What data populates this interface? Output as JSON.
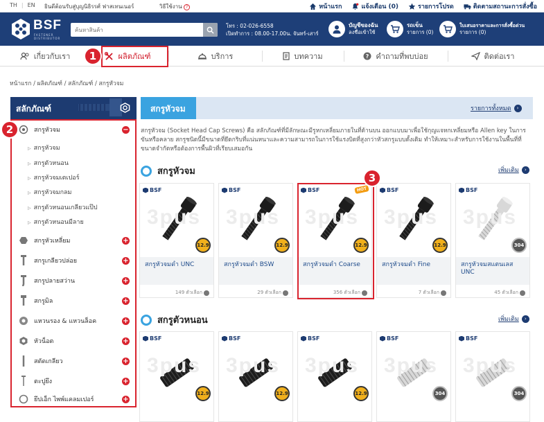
{
  "topbar": {
    "lang_th": "TH",
    "lang_sep": "|",
    "lang_en": "EN",
    "welcome": "ยินดีต้อนรับสู่บุญนิธิรรศ์ ฟาสเทนเนอร์",
    "how": "วิธีใช้งาน",
    "nav": [
      {
        "label": "หน้าแรก",
        "icon": "home-icon"
      },
      {
        "label": "แจ้งเตือน (0)",
        "icon": "bell-icon"
      },
      {
        "label": "รายการโปรด",
        "icon": "star-icon"
      },
      {
        "label": "ติดตามสถานะการสั่งซื้อ",
        "icon": "truck-icon"
      }
    ]
  },
  "header": {
    "brand": "BSF",
    "brand_sub": "FASTENER DISTRIBUTOR",
    "search_placeholder": "ค้นหาสินค้า",
    "phone": "โทร : 02-026-6558",
    "hours": "เปิดทำการ : 08.00-17.00น. จันทร์-เสาร์",
    "account_line1": "บัญชีของฉัน",
    "account_line2": "ลงชื่อเข้าใช้",
    "cart_line1": "รถเข็น",
    "cart_line2": "รายการ (0)",
    "quote_line1": "ใบเสนอราคาและการสั่งซื้อด่วน",
    "quote_line2": "รายการ (0)"
  },
  "catnav": [
    {
      "label": "เกี่ยวกับเรา",
      "icon": "people-icon"
    },
    {
      "label": "ผลิตภัณฑ์",
      "icon": "tools-icon"
    },
    {
      "label": "บริการ",
      "icon": "service-icon"
    },
    {
      "label": "บทความ",
      "icon": "document-icon"
    },
    {
      "label": "คำถามที่พบบ่อย",
      "icon": "help-icon"
    },
    {
      "label": "ติดต่อเรา",
      "icon": "send-icon"
    }
  ],
  "badges": [
    "1",
    "2",
    "3"
  ],
  "breadcrumb": "หน้าแรก / ผลิตภัณฑ์ / สลักภัณฑ์ / สกรูหัวจม",
  "sidebar": {
    "title": "สลักภัณฑ์",
    "categories": [
      {
        "label": "สกรูหัวจม",
        "expanded": true
      },
      {
        "label": "สกรูหัวเหลี่ยม"
      },
      {
        "label": "สกรูเกลียวปล่อย"
      },
      {
        "label": "สกรูปลายสว่าน"
      },
      {
        "label": "สกรูมิล"
      },
      {
        "label": "แหวนรอง & แหวนล็อค"
      },
      {
        "label": "หัวน็อต"
      },
      {
        "label": "สตัดเกลียว"
      },
      {
        "label": "ตะปูยึง"
      },
      {
        "label": "ยึปเอ็ก ไพพ์แคลมเปอร์"
      }
    ],
    "subitems": [
      "สกรูหัวจม",
      "สกรูตัวหนอน",
      "สกรูหัวจมเตเปอร์",
      "สกรูหัวจมกลม",
      "สกรูตัวหนอนเกลียวแป๊ป",
      "สกรูตัวหนอนมีลาย"
    ]
  },
  "banner": {
    "title": "สกรูหัวจม",
    "all_link": "รายการทั้งหมด"
  },
  "description": "สกรูหัวจม (Socket Head Cap Screws) คือ สลักภัณฑ์ที่มีลักษณะมีรูหกเหลี่ยมภายในที่ด้านบน ออกแบบมาเพื่อใช้กุญแจหกเหลี่ยมหรือ Allen key ในการขันหรือคลาย สกรูชนิดนี้มีขนาดที่ยึดกริบที่แน่นหนาและความสามารถในการใช้แรงบิดที่สูงกว่าหัวสกรูแบบดั้งเดิม ทำให้เหมาะสำหรับการใช้งานในพื้นที่ที่ขนาดจำกัดหรือต้องการพื้นผิวที่เรียบเสมอกัน",
  "sections": [
    {
      "title": "สกรูหัวจม",
      "more": "เพิ่มเติม",
      "products": [
        {
          "name": "สกรูหัวจมดำ UNC",
          "count": "149 ตัวเลือก",
          "grade": "12.9",
          "white": false,
          "hot": false
        },
        {
          "name": "สกรูหัวจมดำ BSW",
          "count": "29 ตัวเลือก",
          "grade": "12.9",
          "white": false,
          "hot": false
        },
        {
          "name": "สกรูหัวจมดำ Coarse",
          "count": "356 ตัวเลือก",
          "grade": "12.9",
          "white": false,
          "hot": true
        },
        {
          "name": "สกรูหัวจมดำ Fine",
          "count": "7 ตัวเลือก",
          "grade": "12.9",
          "white": false,
          "hot": false
        },
        {
          "name": "สกรูหัวจมสแตนเลส UNC",
          "count": "45 ตัวเลือก",
          "grade": "304",
          "white": true,
          "hot": false
        }
      ]
    },
    {
      "title": "สกรูตัวหนอน",
      "more": "เพิ่มเติม",
      "products": [
        {
          "grade": "12.9",
          "white": false
        },
        {
          "grade": "12.9",
          "white": false
        },
        {
          "grade": "12.9",
          "white": false
        },
        {
          "grade": "304",
          "white": true
        },
        {
          "grade": "304",
          "white": true
        }
      ]
    }
  ],
  "card_brand": "BSF",
  "watermark": "3pus",
  "hot_label": "HOT",
  "colors": {
    "navy": "#1e3f78",
    "accent_blue": "#3aa3e0",
    "red": "#d9232e",
    "grade_gold": "#f1b01c"
  }
}
